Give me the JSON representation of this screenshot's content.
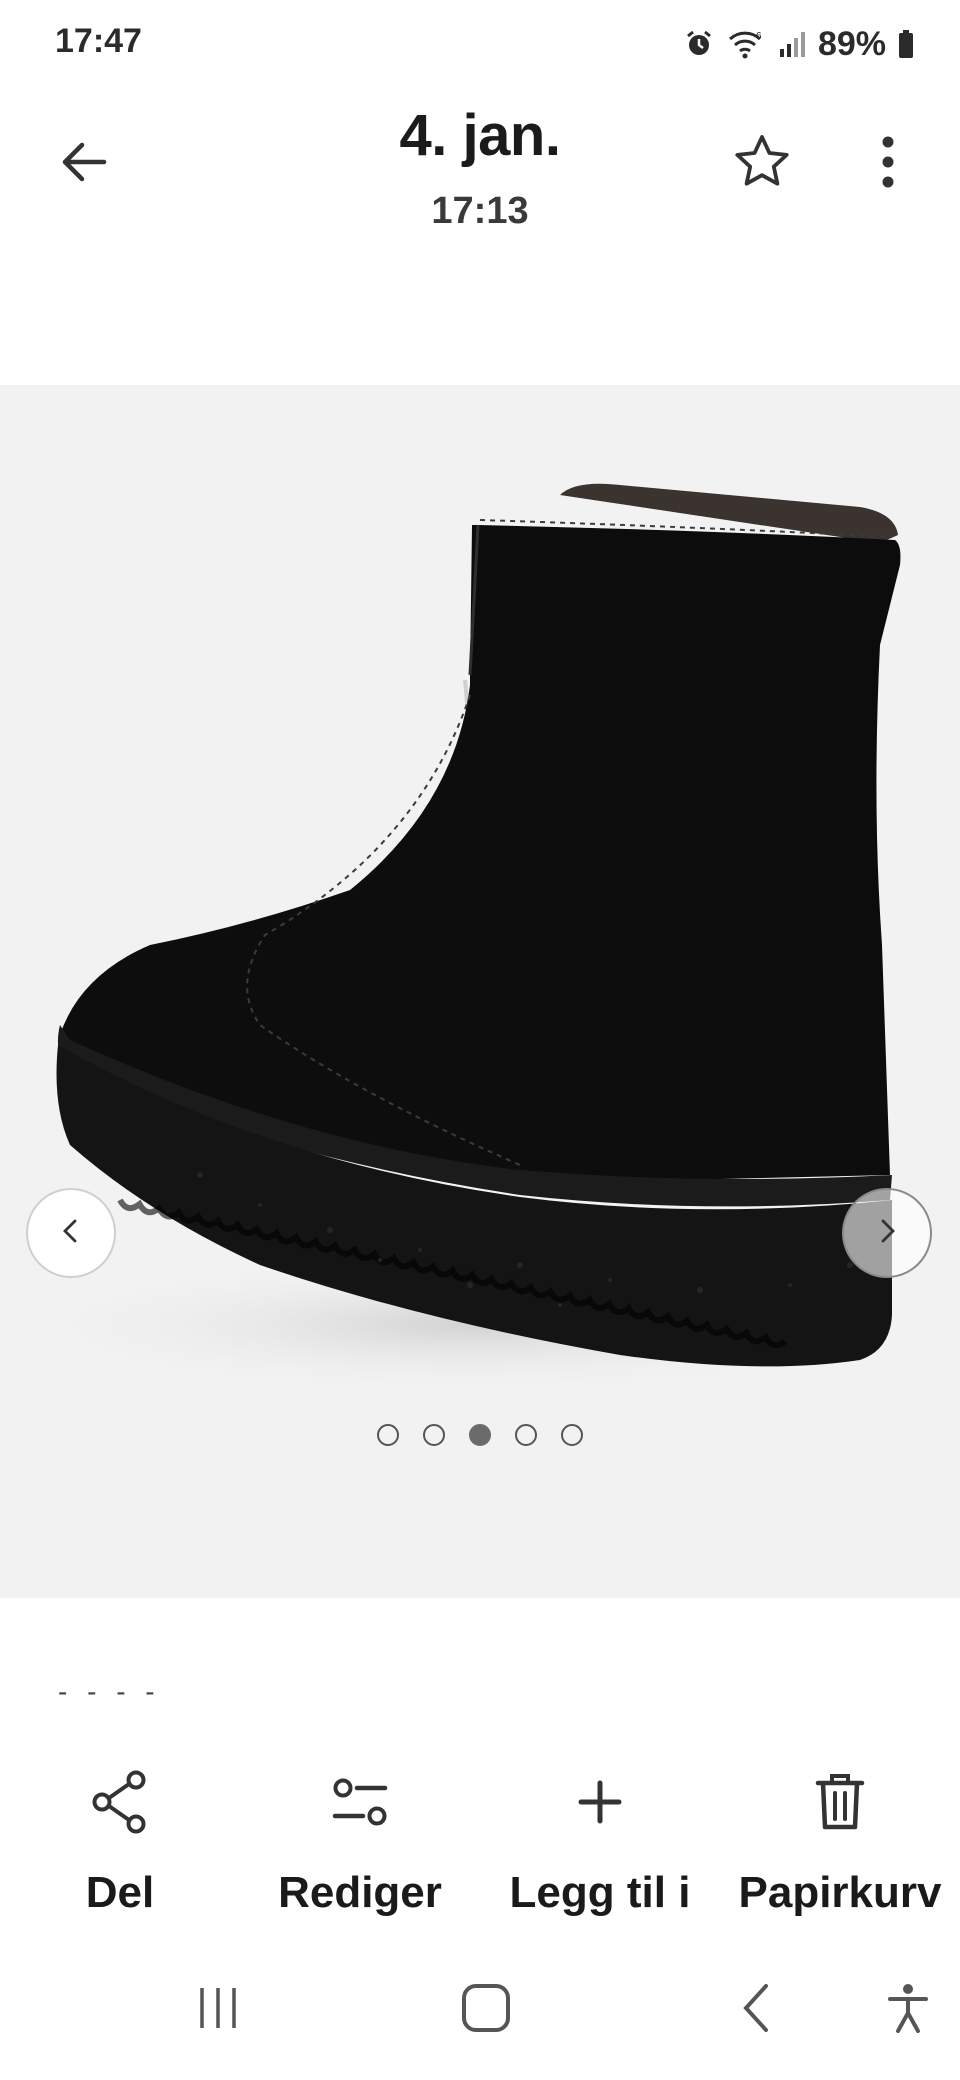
{
  "status_bar": {
    "time": "17:47",
    "battery": "89%",
    "icons": [
      "alarm-icon",
      "wifi-icon",
      "signal-icon",
      "battery-icon"
    ]
  },
  "header": {
    "date": "4. jan.",
    "time": "17:13",
    "icons": [
      "back-arrow-icon",
      "star-icon",
      "more-vert-icon"
    ]
  },
  "viewer": {
    "carousel_total": 5,
    "carousel_active_index": 2,
    "nav_icons": [
      "chevron-left-icon",
      "chevron-right-icon"
    ]
  },
  "caption_fragment": "- - -         -",
  "actions": [
    {
      "label": "Del",
      "icon": "share-icon"
    },
    {
      "label": "Rediger",
      "icon": "edit-sliders-icon"
    },
    {
      "label": "Legg til i",
      "icon": "plus-icon"
    },
    {
      "label": "Papirkurv",
      "icon": "trash-icon"
    }
  ],
  "system_nav": [
    "recents-icon",
    "home-icon",
    "back-icon",
    "accessibility-icon"
  ],
  "colors": {
    "photo_background": "#f2f2f2",
    "boot": "#0c0c0c",
    "text_primary": "#1b1b1b"
  }
}
